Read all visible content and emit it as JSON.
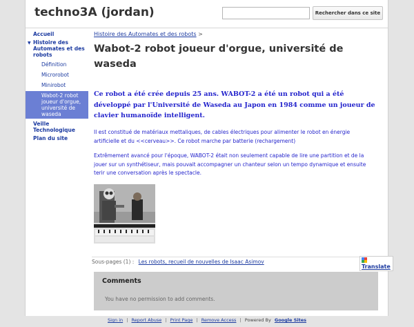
{
  "header": {
    "site_title": "techno3A (jordan)",
    "search_placeholder": "",
    "search_button": "Rechercher dans ce site"
  },
  "sidebar": {
    "items": [
      {
        "label": "Accueil"
      },
      {
        "label": "Histoire des Automates et des robots"
      },
      {
        "label": "Définition"
      },
      {
        "label": "Microrobot"
      },
      {
        "label": "Minirobot"
      },
      {
        "label": "Wabot-2 robot joueur d'orgue, université de waseda"
      },
      {
        "label": "Veille Technologique"
      },
      {
        "label": "Plan du site"
      }
    ]
  },
  "breadcrumb": {
    "parent": "Histoire des Automates et des robots",
    "separator": ">"
  },
  "page": {
    "title": "Wabot-2 robot joueur d'orgue, université de waseda",
    "lead": "Ce robot a été crée depuis 25 ans. WABOT-2 a été un robot qui a été développé par l'Université de Waseda au Japon en 1984 comme un joueur de clavier humanoïde intelligent.",
    "para1": "Il est constitué de matériaux mettaliques, de cables électriques pour alimenter le robot en énergie artificielle et du <<cerveau>>. Ce robot marche par batterie (rechargement)",
    "para2": "Extrêmement avancé pour l'époque, WABOT-2 était non seulement capable de lire une partition et de la jouer sur un synthétiseur, mais pouvait accompagner un chanteur selon un tempo dynamique et ensuite terir une conversation après le spectacle."
  },
  "subpages": {
    "label": "Sous-pages (1) :",
    "link": "Les robots, recueil de nouvelles de Isaac Asimov"
  },
  "translate": {
    "label": "Translate"
  },
  "comments": {
    "title": "Comments",
    "note": "You have no permission to add comments."
  },
  "footer": {
    "sign_in": "Sign in",
    "report_abuse": "Report Abuse",
    "print_page": "Print Page",
    "remove_access": "Remove Access",
    "powered_by": "Powered By",
    "google_sites": "Google Sites",
    "separator": "|"
  },
  "colors": {
    "accent_link": "#1b3aa0",
    "body_text_blue": "#2424cc",
    "selected_nav": "#6b7fd4",
    "comments_bg": "#cccccc"
  }
}
